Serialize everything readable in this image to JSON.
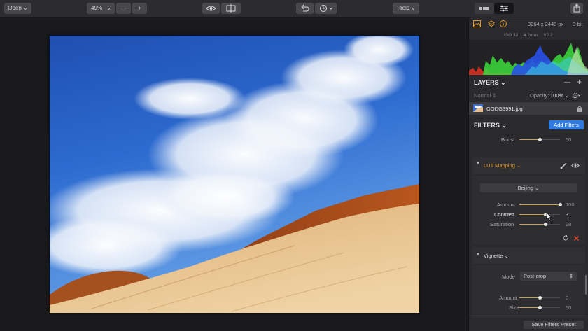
{
  "toolbar": {
    "open_label": "Open ⌄",
    "zoom_value": "49%",
    "zoom_out": "—",
    "zoom_in": "+",
    "tools_label": "Tools ⌄"
  },
  "info": {
    "dimensions": "3264 x 2448 px",
    "bit_depth": "8-bit",
    "iso": "ISO 32",
    "focal": "4.2mm",
    "aperture": "f/2.2"
  },
  "layers": {
    "title": "LAYERS ⌄",
    "minus": "—",
    "plus": "+",
    "blend_mode": "Normal ⇕",
    "opacity_label": "Opacity:",
    "opacity_value": "100% ⌄",
    "layer_name": "GODG3991.jpg"
  },
  "filters": {
    "title": "FILTERS ⌄",
    "add_button": "Add Filters",
    "boost": {
      "label": "Boost",
      "value": "50",
      "level": 0.5
    },
    "lut": {
      "title": "LUT Mapping ⌄",
      "preset": "Beijing ⌄",
      "amount": {
        "label": "Amount",
        "value": "100",
        "level": 1.0
      },
      "contrast": {
        "label": "Contrast",
        "value": "31",
        "level": 0.65
      },
      "saturation": {
        "label": "Saturation",
        "value": "28",
        "level": 0.64
      }
    },
    "vignette": {
      "title": "Vignette ⌄",
      "mode_label": "Mode",
      "mode_value": "Post-crop",
      "amount": {
        "label": "Amount",
        "value": "0",
        "level": 0.5
      },
      "size": {
        "label": "Size",
        "value": "50",
        "level": 0.5
      }
    },
    "save_preset": "Save Filters Preset"
  },
  "colors": {
    "accent_orange": "#e09a2c",
    "accent_blue": "#2f7be0",
    "reset_red": "#e0442c"
  }
}
